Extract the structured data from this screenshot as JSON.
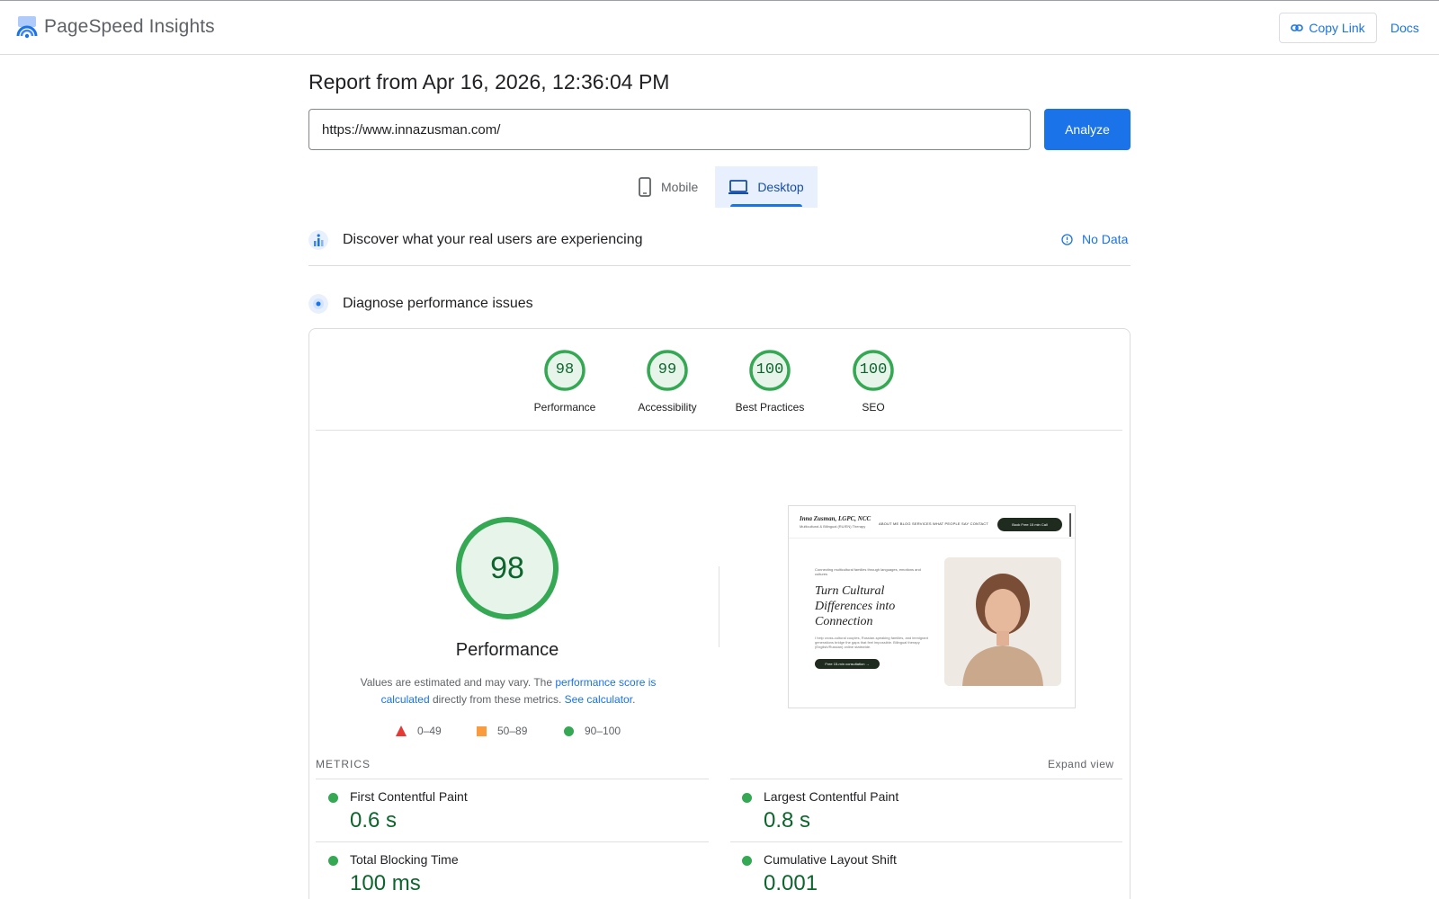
{
  "app": {
    "brand": "PageSpeed Insights",
    "copy_link": "Copy Link",
    "docs": "Docs"
  },
  "report": {
    "title": "Report from Apr 16, 2026, 12:36:04 PM",
    "url": "https://www.innazusman.com/",
    "analyze_label": "Analyze"
  },
  "tabs": [
    {
      "label": "Mobile",
      "selected": false
    },
    {
      "label": "Desktop",
      "selected": true
    }
  ],
  "field_data": {
    "title": "Discover what your real users are experiencing",
    "status": "No Data"
  },
  "diagnose": {
    "title": "Diagnose performance issues"
  },
  "categories": [
    {
      "label": "Performance",
      "score": "98"
    },
    {
      "label": "Accessibility",
      "score": "99"
    },
    {
      "label": "Best Practices",
      "score": "100"
    },
    {
      "label": "SEO",
      "score": "100"
    }
  ],
  "performance": {
    "score": "98",
    "label": "Performance",
    "note_prefix": "Values are estimated and may vary. The ",
    "note_link1": "performance score is calculated",
    "note_middle": " directly from these metrics. ",
    "note_link2": "See calculator",
    "note_suffix": "."
  },
  "legend": [
    {
      "range": "0–49",
      "shape": "triangle",
      "color": "#e53935"
    },
    {
      "range": "50–89",
      "shape": "square",
      "color": "#fa9c3b"
    },
    {
      "range": "90–100",
      "shape": "circle",
      "color": "#34a853"
    }
  ],
  "screenshot": {
    "site_name": "Inna Zusman, LGPC, NCC",
    "site_tagline": "Multicultural & Bilingual (RU/EN) Therapy",
    "menu": "ABOUT ME   BLOG   SERVICES   WHAT PEOPLE SAY   CONTACT",
    "cta": "Book Free 15 min Call",
    "kicker": "Connecting multicultural families through languages, emotions and cultures",
    "hero": "Turn Cultural Differences into Connection",
    "body": "I help cross-cultural couples, Russian-speaking families, and immigrant generations bridge the gaps that feel impossible. Bilingual therapy (English/Russian) online statewide.",
    "button": "Free 15-min consultation →"
  },
  "metrics": {
    "heading": "METRICS",
    "expand": "Expand view",
    "items": [
      {
        "name": "First Contentful Paint",
        "value": "0.6 s"
      },
      {
        "name": "Largest Contentful Paint",
        "value": "0.8 s"
      },
      {
        "name": "Total Blocking Time",
        "value": "100 ms"
      },
      {
        "name": "Cumulative Layout Shift",
        "value": "0.001"
      }
    ]
  },
  "colors": {
    "accent": "#1a73e8",
    "pass_green": "#34a853",
    "pass_text": "#0d652d",
    "gauge_fill": "#e6f4ea"
  }
}
